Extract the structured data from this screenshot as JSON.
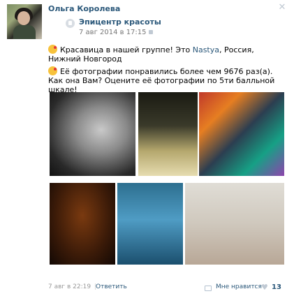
{
  "post": {
    "author": "Ольга Королева",
    "close_icon": "✕"
  },
  "repost": {
    "source": "Эпицентр красоты",
    "date": "7 авг 2014 в 17:15"
  },
  "text": {
    "line1_a": "Красавица в нашей группе! Это ",
    "line1_link": "Nastya",
    "line1_b": ", Россия, Нижний Новгород",
    "line2": "Её фотографии понравились более чем 9676 раз(а).",
    "line3": "Как она Вам? Оцените её фотографии по 5ти балльной шкале!"
  },
  "photos": [
    {
      "alt": "photo-1"
    },
    {
      "alt": "photo-2"
    },
    {
      "alt": "photo-3"
    },
    {
      "alt": "photo-4"
    },
    {
      "alt": "photo-5"
    },
    {
      "alt": "photo-6"
    }
  ],
  "footer": {
    "date": "7 авг в 22:19",
    "separator": "|",
    "reply": "Ответить",
    "like_label": "Мне нравится",
    "heart": "♥",
    "like_count": "13"
  },
  "colors": {
    "link": "#2b587a",
    "meta": "#999999",
    "icon": "#c0c9d3"
  }
}
